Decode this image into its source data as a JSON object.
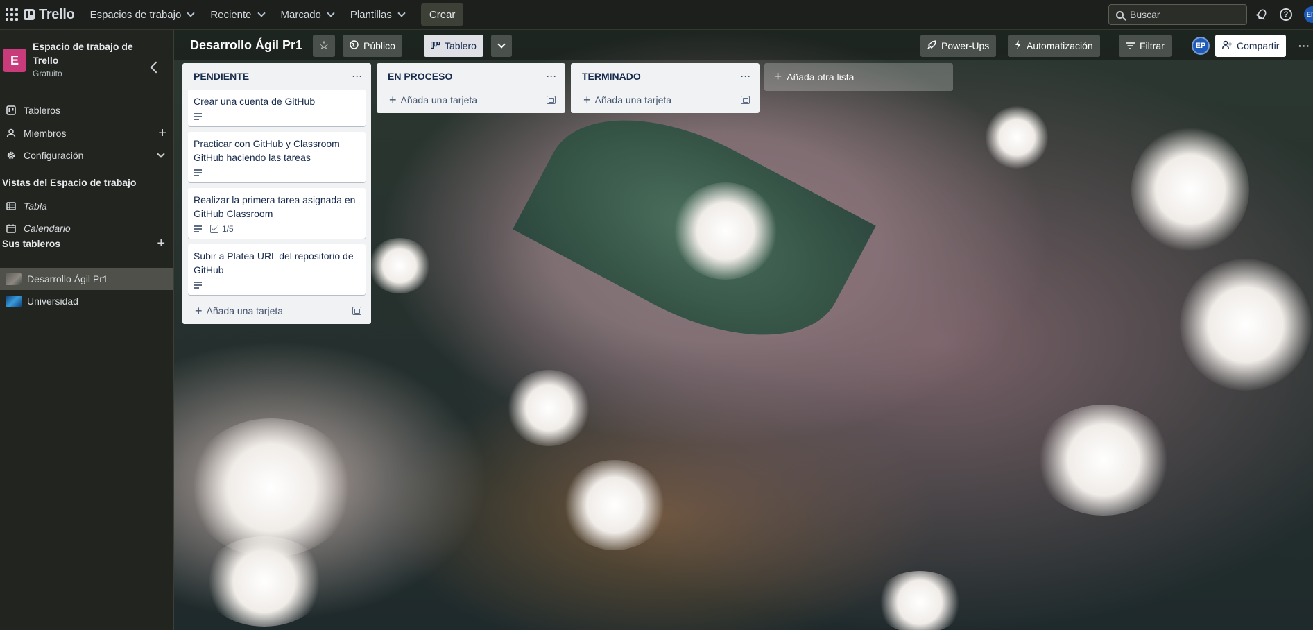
{
  "topbar": {
    "brand": "Trello",
    "nav": [
      {
        "label": "Espacios de trabajo"
      },
      {
        "label": "Reciente"
      },
      {
        "label": "Marcado"
      },
      {
        "label": "Plantillas"
      }
    ],
    "create_label": "Crear",
    "search_placeholder": "Buscar",
    "avatar_initials": "EP"
  },
  "sidebar": {
    "workspace_initial": "E",
    "workspace_name": "Espacio de trabajo de Trello",
    "workspace_plan": "Gratuito",
    "items": [
      {
        "label": "Tableros"
      },
      {
        "label": "Miembros"
      },
      {
        "label": "Configuración"
      }
    ],
    "views_heading": "Vistas del Espacio de trabajo",
    "views": [
      {
        "label": "Tabla"
      },
      {
        "label": "Calendario"
      }
    ],
    "boards_heading": "Sus tableros",
    "boards": [
      {
        "label": "Desarrollo Ágil Pr1",
        "active": true
      },
      {
        "label": "Universidad",
        "active": false
      }
    ]
  },
  "board": {
    "title": "Desarrollo Ágil Pr1",
    "visibility_label": "Público",
    "view_label": "Tablero",
    "powerups_label": "Power-Ups",
    "automation_label": "Automatización",
    "filter_label": "Filtrar",
    "member_initials": "EP",
    "share_label": "Compartir",
    "add_list_label": "Añada otra lista",
    "lists": [
      {
        "title": "PENDIENTE",
        "cards": [
          {
            "title": "Crear una cuenta de GitHub",
            "has_description": true,
            "checklist": ""
          },
          {
            "title": "Practicar con GitHub y Classroom GitHub haciendo las tareas",
            "has_description": true,
            "checklist": ""
          },
          {
            "title": "Realizar la primera tarea asignada en GitHub Classroom",
            "has_description": true,
            "checklist": "1/5"
          },
          {
            "title": "Subir a Platea URL del repositorio de GitHub",
            "has_description": true,
            "checklist": ""
          }
        ],
        "add_card_label": "Añada una tarjeta"
      },
      {
        "title": "EN PROCESO",
        "cards": [],
        "add_card_label": "Añada una tarjeta"
      },
      {
        "title": "TERMINADO",
        "cards": [],
        "add_card_label": "Añada una tarjeta"
      }
    ]
  },
  "colors": {
    "header_bg": "#1d1f1c",
    "sidebar_bg": "#22251f",
    "workspace_avatar": "#c93b7b",
    "list_bg": "#f1f2f4",
    "member_avatar": "#1e5bb8"
  }
}
